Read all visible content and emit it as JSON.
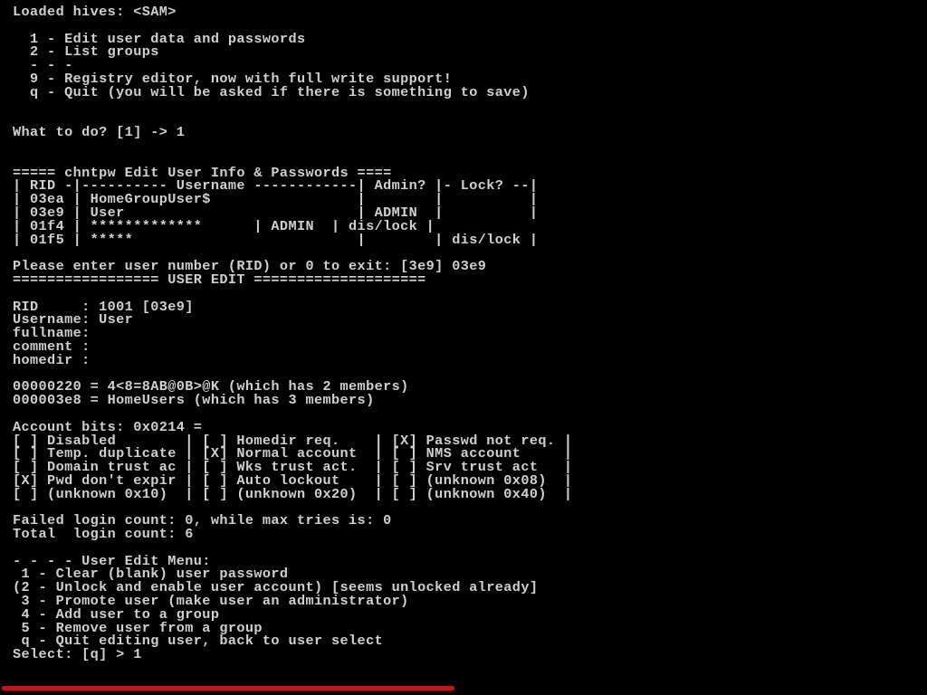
{
  "term": {
    "loaded_hives": "Loaded hives: <SAM>",
    "main_menu": {
      "opt1": "  1 - Edit user data and passwords",
      "opt2": "  2 - List groups",
      "sep": "  - - -",
      "opt9": "  9 - Registry editor, now with full write support!",
      "optq": "  q - Quit (you will be asked if there is something to save)"
    },
    "what_to_do": "What to do? [1] -> 1",
    "edit_header": "===== chntpw Edit User Info & Passwords ====",
    "user_table": {
      "hdr": "| RID -|---------- Username ------------| Admin? |- Lock? --|",
      "row1": "| 03ea | HomeGroupUser$                 |        |          |",
      "row2": "| 03e9 | User                           | ADMIN  |          |",
      "row3": "| 01f4 | *************      | ADMIN  | dis/lock |",
      "row4": "| 01f5 | *****                          |        | dis/lock |"
    },
    "please_enter": "Please enter user number (RID) or 0 to exit: [3e9] 03e9",
    "user_edit_banner": "================= USER EDIT ====================",
    "user_info": {
      "rid": "RID     : 1001 [03e9]",
      "username": "Username: User",
      "fullname": "fullname:",
      "comment": "comment :",
      "homedir": "homedir :"
    },
    "groups": {
      "g1": "00000220 = 4<8=8AB@0B>@K (which has 2 members)",
      "g2": "000003e8 = HomeUsers (which has 3 members)"
    },
    "account_bits_header": "Account bits: 0x0214 =",
    "account_bits": {
      "r1": "[ ] Disabled        | [ ] Homedir req.    | [X] Passwd not req. |",
      "r2": "[ ] Temp. duplicate | [X] Normal account  | [ ] NMS account     |",
      "r3": "[ ] Domain trust ac | [ ] Wks trust act.  | [ ] Srv trust act   |",
      "r4": "[X] Pwd don't expir | [ ] Auto lockout    | [ ] (unknown 0x08)  |",
      "r5": "[ ] (unknown 0x10)  | [ ] (unknown 0x20)  | [ ] (unknown 0x40)  |"
    },
    "login_counts": {
      "failed": "Failed login count: 0, while max tries is: 0",
      "total": "Total  login count: 6"
    },
    "edit_menu": {
      "title": "- - - - User Edit Menu:",
      "m1": " 1 - Clear (blank) user password",
      "m2": "(2 - Unlock and enable user account) [seems unlocked already]",
      "m3": " 3 - Promote user (make user an administrator)",
      "m4": " 4 - Add user to a group",
      "m5": " 5 - Remove user from a group",
      "mq": " q - Quit editing user, back to user select"
    },
    "select_prompt": "Select: [q] > 1"
  }
}
